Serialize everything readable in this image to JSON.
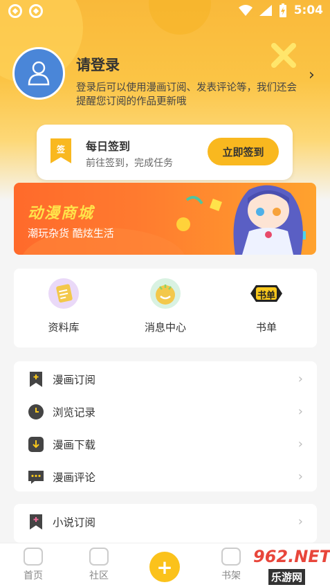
{
  "status_bar": {
    "time": "5:04"
  },
  "profile": {
    "title": "请登录",
    "description": "登录后可以使用漫画订阅、发表评论等，我们还会提醒您订阅的作品更新哦"
  },
  "signin": {
    "badge": "签",
    "title": "每日签到",
    "subtitle": "前往签到，完成任务",
    "button": "立即签到"
  },
  "banner": {
    "title": "动漫商城",
    "subtitle": "潮玩杂货 酷炫生活"
  },
  "grid": [
    {
      "label": "资料库",
      "icon": "library-icon",
      "color": "#f3c84b"
    },
    {
      "label": "消息中心",
      "icon": "message-center-icon",
      "color": "#8ed36a"
    },
    {
      "label": "书单",
      "icon": "book-list-icon",
      "color": "#f9c81c"
    }
  ],
  "list_group_1": [
    {
      "label": "漫画订阅",
      "icon": "bookmark-plus-icon"
    },
    {
      "label": "浏览记录",
      "icon": "clock-icon"
    },
    {
      "label": "漫画下载",
      "icon": "download-icon"
    },
    {
      "label": "漫画评论",
      "icon": "comment-icon"
    }
  ],
  "list_group_2": [
    {
      "label": "小说订阅",
      "icon": "novel-bookmark-icon"
    }
  ],
  "tabbar": {
    "home": "首页",
    "community": "社区",
    "plus": "+",
    "shelf": "书架"
  },
  "watermark": {
    "top": "962.NET",
    "bottom": "乐游网"
  },
  "colors": {
    "accent": "#f9b81f",
    "avatar": "#4a86d8",
    "banner": "#ff6a2b"
  }
}
